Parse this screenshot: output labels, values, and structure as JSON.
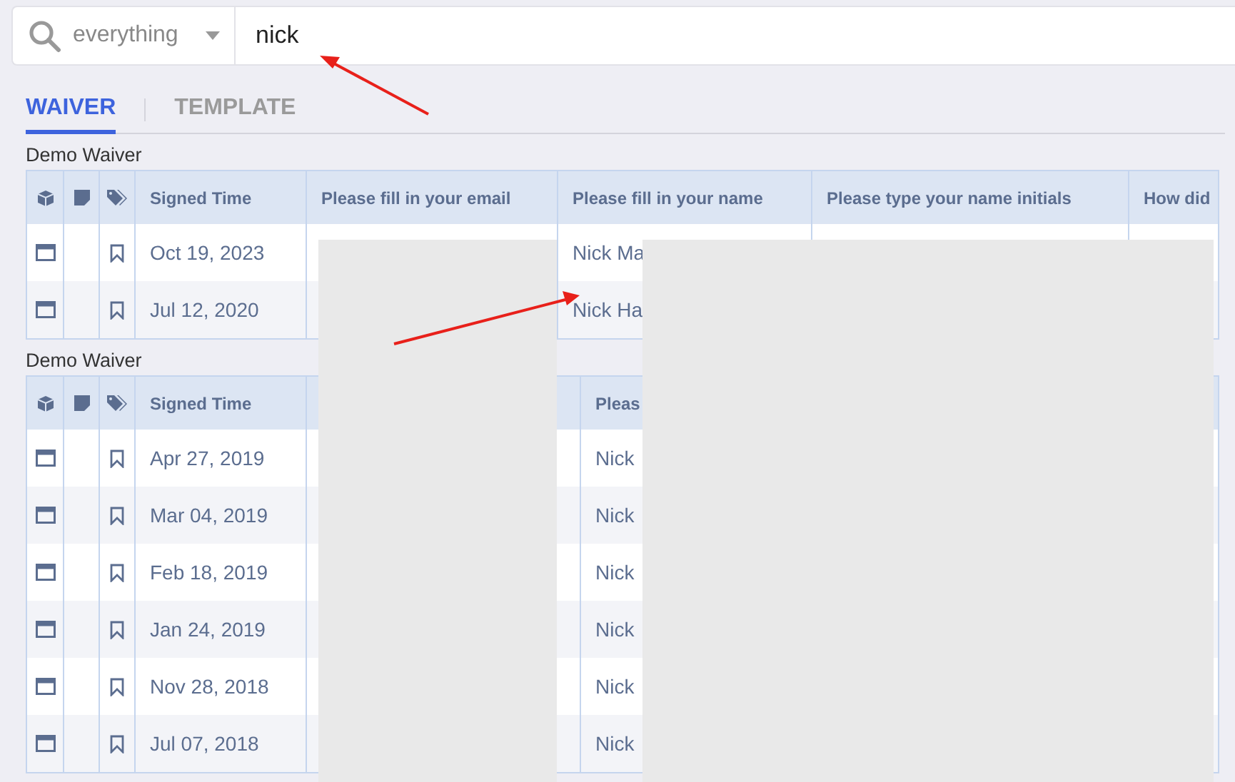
{
  "search": {
    "scope": "everything",
    "value": "nick"
  },
  "tabs": [
    {
      "label": "WAIVER",
      "selected": true
    },
    {
      "label": "TEMPLATE",
      "selected": false
    }
  ],
  "sections": [
    {
      "title": "Demo Waiver",
      "kind": "full",
      "columns": [
        "Signed Time",
        "Please fill in your email",
        "Please fill in your name",
        "Please type your name initials",
        "How did"
      ],
      "rows": [
        {
          "signed_time": "Oct 19, 2023",
          "name": "Nick Ma"
        },
        {
          "signed_time": "Jul 12, 2020",
          "name": "Nick Ha"
        }
      ]
    },
    {
      "title": "Demo Waiver",
      "kind": "partial",
      "columns": [
        "Signed Time",
        "Pleas"
      ],
      "rows": [
        {
          "signed_time": "Apr 27, 2019",
          "name": "Nick"
        },
        {
          "signed_time": "Mar 04, 2019",
          "name": "Nick"
        },
        {
          "signed_time": "Feb 18, 2019",
          "name": "Nick"
        },
        {
          "signed_time": "Jan 24, 2019",
          "name": "Nick"
        },
        {
          "signed_time": "Nov 28, 2018",
          "name": "Nick"
        },
        {
          "signed_time": "Jul 07, 2018",
          "name": "Nick"
        }
      ]
    }
  ]
}
